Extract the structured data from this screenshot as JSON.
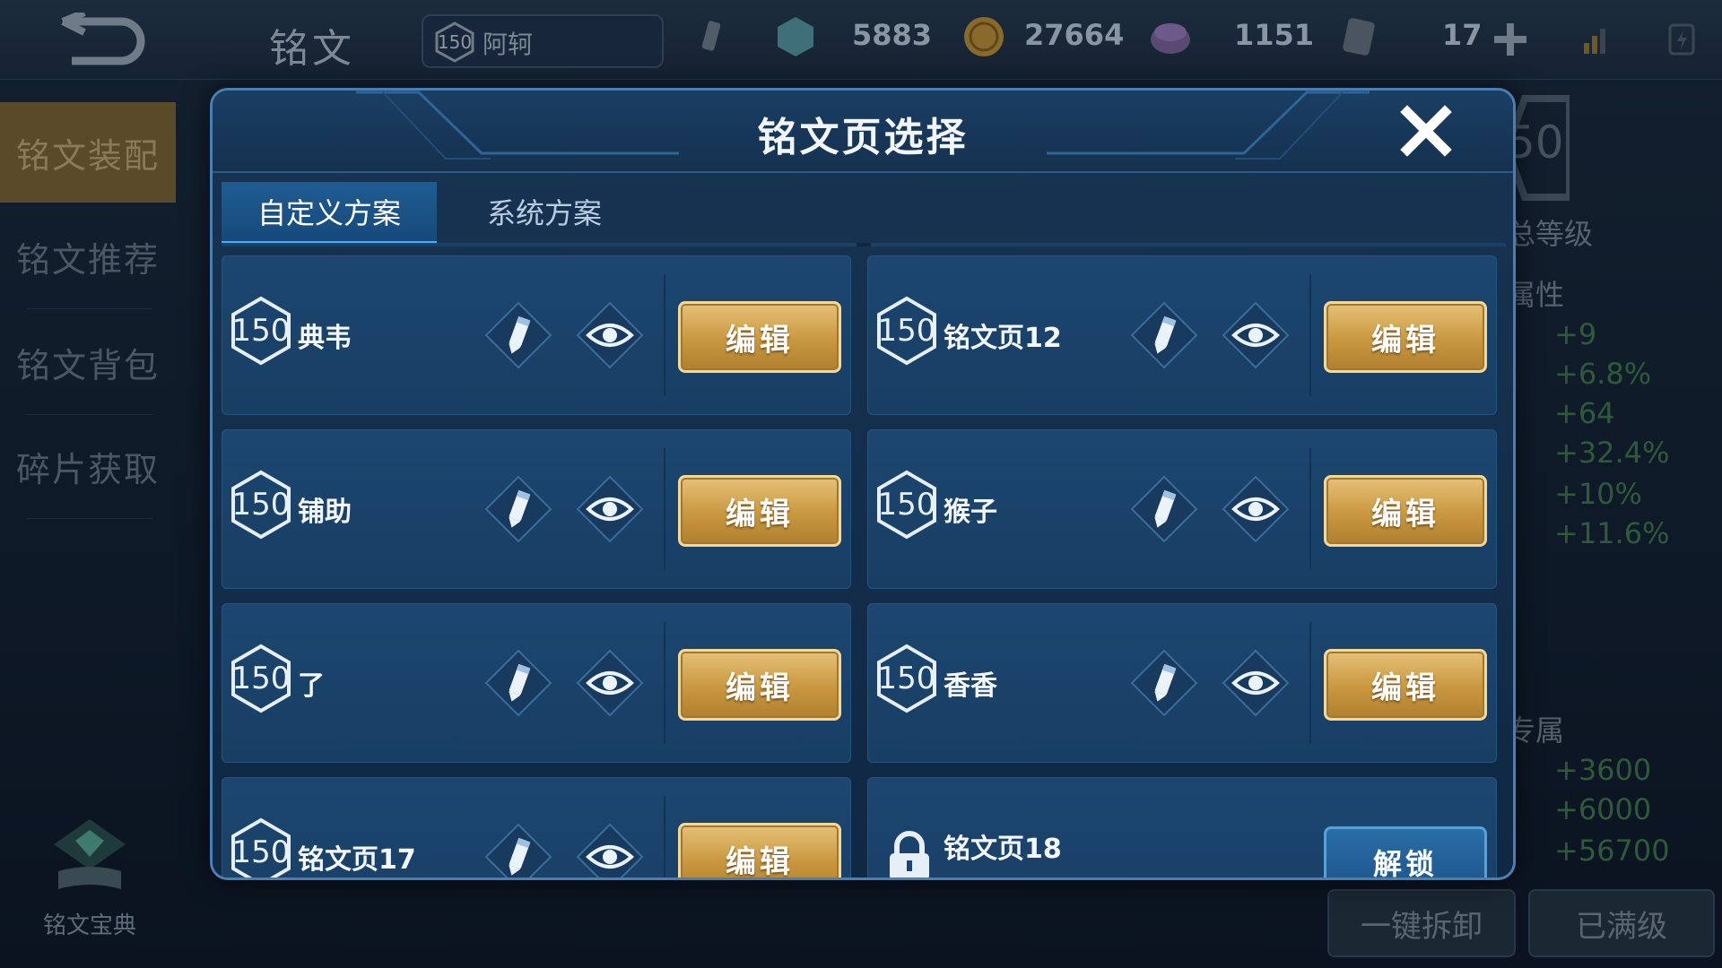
{
  "topbar": {
    "title": "铭文",
    "hero": {
      "level": "150",
      "name": "阿轲"
    },
    "resources": [
      {
        "icon": "crystal-icon",
        "value": "5883"
      },
      {
        "icon": "gold-coin-icon",
        "value": "27664"
      },
      {
        "icon": "gem-chest-icon",
        "value": "1151"
      },
      {
        "icon": "voucher-icon",
        "value": "17"
      }
    ]
  },
  "sidebar": {
    "items": [
      {
        "label": "铭文装配",
        "active": true
      },
      {
        "label": "铭文推荐",
        "active": false
      },
      {
        "label": "铭文背包",
        "active": false
      },
      {
        "label": "碎片获取",
        "active": false
      }
    ],
    "codex_label": "铭文宝典"
  },
  "right_panel": {
    "level_number": "50",
    "total_level": "总等级",
    "attr_header": "属性",
    "attr_values": [
      "+9",
      "+6.8%",
      "+64",
      "+32.4%",
      "+10%",
      "+11.6%"
    ],
    "exclusive_header": "专属",
    "exclusive_values": [
      "+3600",
      "+6000",
      "+56700"
    ],
    "one_click_dismantle": "一键拆卸",
    "max_level": "已满级"
  },
  "modal": {
    "title": "铭文页选择",
    "tabs": [
      {
        "label": "自定义方案",
        "active": true
      },
      {
        "label": "系统方案",
        "active": false
      }
    ],
    "edit_label": "编辑",
    "unlock_label": "解锁",
    "pages": [
      {
        "level": "150",
        "name": "典韦",
        "locked": false
      },
      {
        "level": "150",
        "name": "铭文页12",
        "locked": false
      },
      {
        "level": "150",
        "name": "铺助",
        "locked": false
      },
      {
        "level": "150",
        "name": "猴子",
        "locked": false
      },
      {
        "level": "150",
        "name": "了",
        "locked": false
      },
      {
        "level": "150",
        "name": "香香",
        "locked": false
      },
      {
        "level": "150",
        "name": "铭文页17",
        "locked": false
      },
      {
        "level": "",
        "name": "铭文页18",
        "locked": true
      }
    ]
  },
  "colors": {
    "accent_gold": "#d4a651",
    "tab_active": "#1f5c93",
    "card_bg": "#1c4670"
  }
}
